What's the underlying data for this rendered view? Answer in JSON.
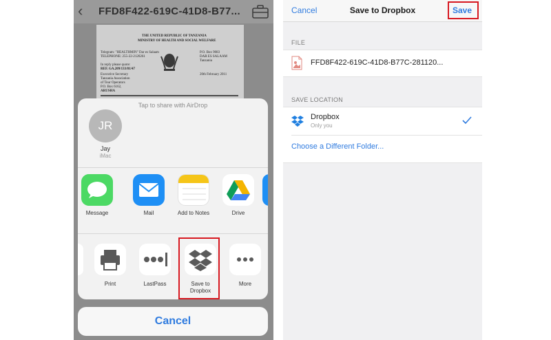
{
  "left": {
    "title": "FFD8F422-619C-41D8-B77...",
    "back_icon": "chevron-left-icon",
    "briefcase_icon": "briefcase-icon",
    "document": {
      "lines": [
        "THE UNITED REPUBLIC OF TANZANIA",
        "MINISTRY OF HEALTH AND SOCIAL WELFARE",
        "Telegram: \"HEALTHMIN\" Dar es Salaam",
        "TELEPHONE: 255-22-2120261",
        "In reply please quote:",
        "REF. GA.209/133/81/47",
        "Executive Secretary",
        "Tanzania Association",
        "of Tour Operators",
        "P.O. Box 6162,",
        "ARUSHA",
        "P.O. Box 9083",
        "DAR ES SALAAM",
        "Tanzania",
        "20th February 2011"
      ]
    },
    "airdrop_label": "Tap to share with AirDrop",
    "person": {
      "initials": "JR",
      "name": "Jay",
      "device": "iMac"
    },
    "apps": [
      {
        "label": "Message",
        "icon": "messages-icon"
      },
      {
        "label": "Mail",
        "icon": "mail-icon"
      },
      {
        "label": "Add to Notes",
        "icon": "notes-icon"
      },
      {
        "label": "Drive",
        "icon": "drive-icon"
      }
    ],
    "actions": [
      {
        "label": "Print",
        "icon": "printer-icon"
      },
      {
        "label": "LastPass",
        "icon": "lastpass-icon"
      },
      {
        "label": "Save to\nDropbox",
        "icon": "dropbox-icon"
      },
      {
        "label": "More",
        "icon": "more-icon"
      }
    ],
    "cancel_label": "Cancel"
  },
  "right": {
    "cancel_label": "Cancel",
    "title": "Save to Dropbox",
    "save_label": "Save",
    "file_section": "FILE",
    "file_name": "FFD8F422-619C-41D8-B77C-281120...",
    "location_section": "SAVE LOCATION",
    "location_name": "Dropbox",
    "location_sub": "Only you",
    "choose_folder": "Choose a Different Folder..."
  },
  "colors": {
    "ios_blue": "#2f7bdf",
    "highlight_red": "#d7171f",
    "dropbox_blue": "#1f7fe0"
  }
}
